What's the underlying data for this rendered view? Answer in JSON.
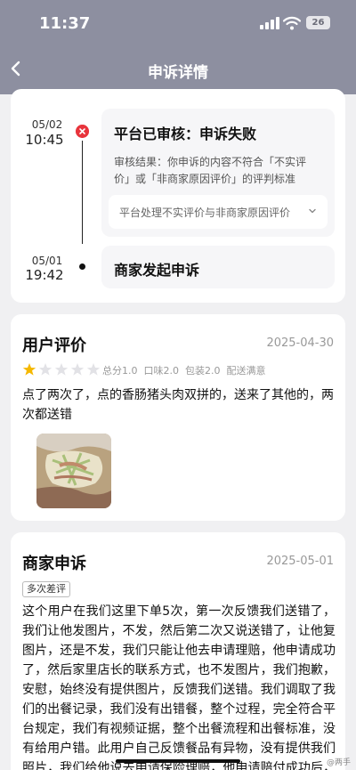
{
  "status_bar": {
    "time": "11:37",
    "battery": "26"
  },
  "nav": {
    "title": "申诉详情"
  },
  "timeline": [
    {
      "date": "05/02",
      "time": "10:45",
      "title": "平台已审核：申诉失败",
      "result_text": "审核结果：你申诉的内容不符合「不实评价」或「非商家原因评价」的评判标准",
      "dropdown_label": "平台处理不实评价与非商家原因评价"
    },
    {
      "date": "05/01",
      "time": "19:42",
      "title": "商家发起申诉"
    }
  ],
  "user_review": {
    "heading": "用户评价",
    "date": "2025-04-30",
    "stars": 1,
    "stars_max": 5,
    "scores": [
      "总分1.0",
      "口味2.0",
      "包装2.0",
      "配送满意"
    ],
    "text": "点了两次了，点的香肠猪头肉双拼的，送来了其他的，两次都送错"
  },
  "merchant_appeal": {
    "heading": "商家申诉",
    "date": "2025-05-01",
    "tag": "多次差评",
    "text": "这个用户在我们这里下单5次，第一次反馈我们送错了，我们让他发图片，不发，然后第二次又说送错了，让他复图片，还是不发，我们只能让他去申请理赔，他申请成功了，然后家里店长的联系方式，也不发图片，我们抱歉，安慰，始终没有提供图片，反馈我们送错。我们调取了我们的出餐记录，我们没有出错餐，整个过程，完全符合平台规定，我们有视频证据，整个出餐流程和出餐标准，没有给用户错。此用户自己反馈餐品有异物，没有提供我们照片，我们给他说去申请保险理赔，他申请赔付成功后，联系我们要补偿，我们给了"
  },
  "watermark": "@两手",
  "colors": {
    "header": "#8d8fa0",
    "fail": "#e8343c",
    "star": "#f5b800"
  }
}
